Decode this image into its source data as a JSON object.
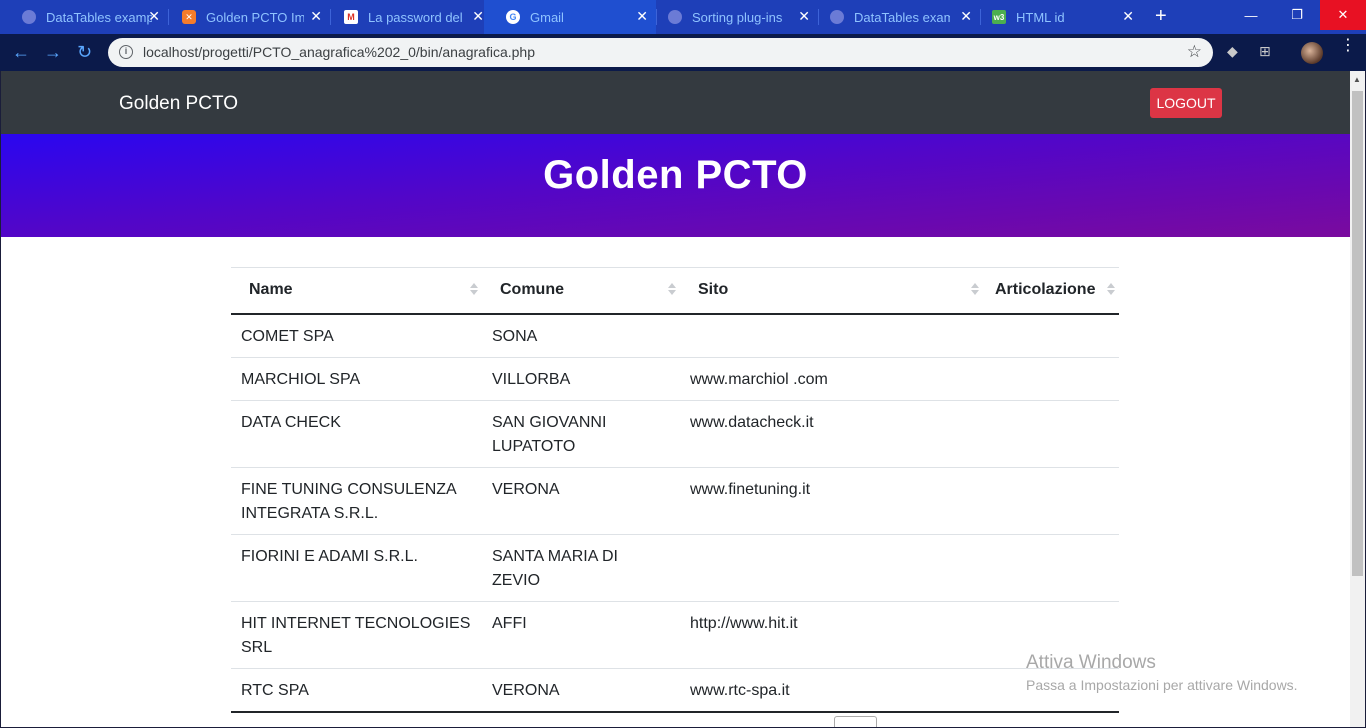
{
  "browser": {
    "tabs": [
      {
        "title": "DataTables example",
        "icon": "globe-icon",
        "color": "#6b7bd6"
      },
      {
        "title": "Golden PCTO Image",
        "icon": "xampp-icon",
        "color": "#f57c2b"
      },
      {
        "title": "La password del tuo",
        "icon": "gmail-icon",
        "color": "#d93025"
      },
      {
        "title": "Gmail",
        "icon": "google-icon",
        "color": "#ffffff"
      },
      {
        "title": "Sorting plug-ins",
        "icon": "globe-icon",
        "color": "#6b7bd6"
      },
      {
        "title": "DataTables example",
        "icon": "globe-icon",
        "color": "#6b7bd6"
      },
      {
        "title": "HTML id",
        "icon": "w3schools-icon",
        "color": "#4caf50"
      }
    ],
    "url": "localhost/progetti/PCTO_anagrafica%202_0/bin/anagrafica.php"
  },
  "navbar": {
    "brand": "Golden PCTO",
    "logout_label": "LOGOUT"
  },
  "hero": {
    "title": "Golden PCTO"
  },
  "table": {
    "columns": [
      "Name",
      "Comune",
      "Sito",
      "Articolazione"
    ],
    "rows": [
      {
        "name": "COMET SPA",
        "comune": "SONA",
        "sito": "",
        "articolazione": ""
      },
      {
        "name": "MARCHIOL SPA",
        "comune": "VILLORBA",
        "sito": "www.marchiol .com",
        "articolazione": ""
      },
      {
        "name": "DATA CHECK",
        "comune": "SAN GIOVANNI LUPATOTO",
        "sito": "www.datacheck.it",
        "articolazione": ""
      },
      {
        "name": "FINE TUNING CONSULENZA INTEGRATA S.R.L.",
        "comune": "VERONA",
        "sito": "www.finetuning.it",
        "articolazione": ""
      },
      {
        "name": "FIORINI E ADAMI S.R.L.",
        "comune": "SANTA MARIA DI ZEVIO",
        "sito": "",
        "articolazione": ""
      },
      {
        "name": "HIT INTERNET TECNOLOGIES SRL",
        "comune": "AFFI",
        "sito": "http://www.hit.it",
        "articolazione": ""
      },
      {
        "name": "RTC SPA",
        "comune": "VERONA",
        "sito": "www.rtc-spa.it",
        "articolazione": ""
      }
    ]
  },
  "watermark": {
    "line1": "Attiva Windows",
    "line2": "Passa a Impostazioni per attivare Windows."
  }
}
